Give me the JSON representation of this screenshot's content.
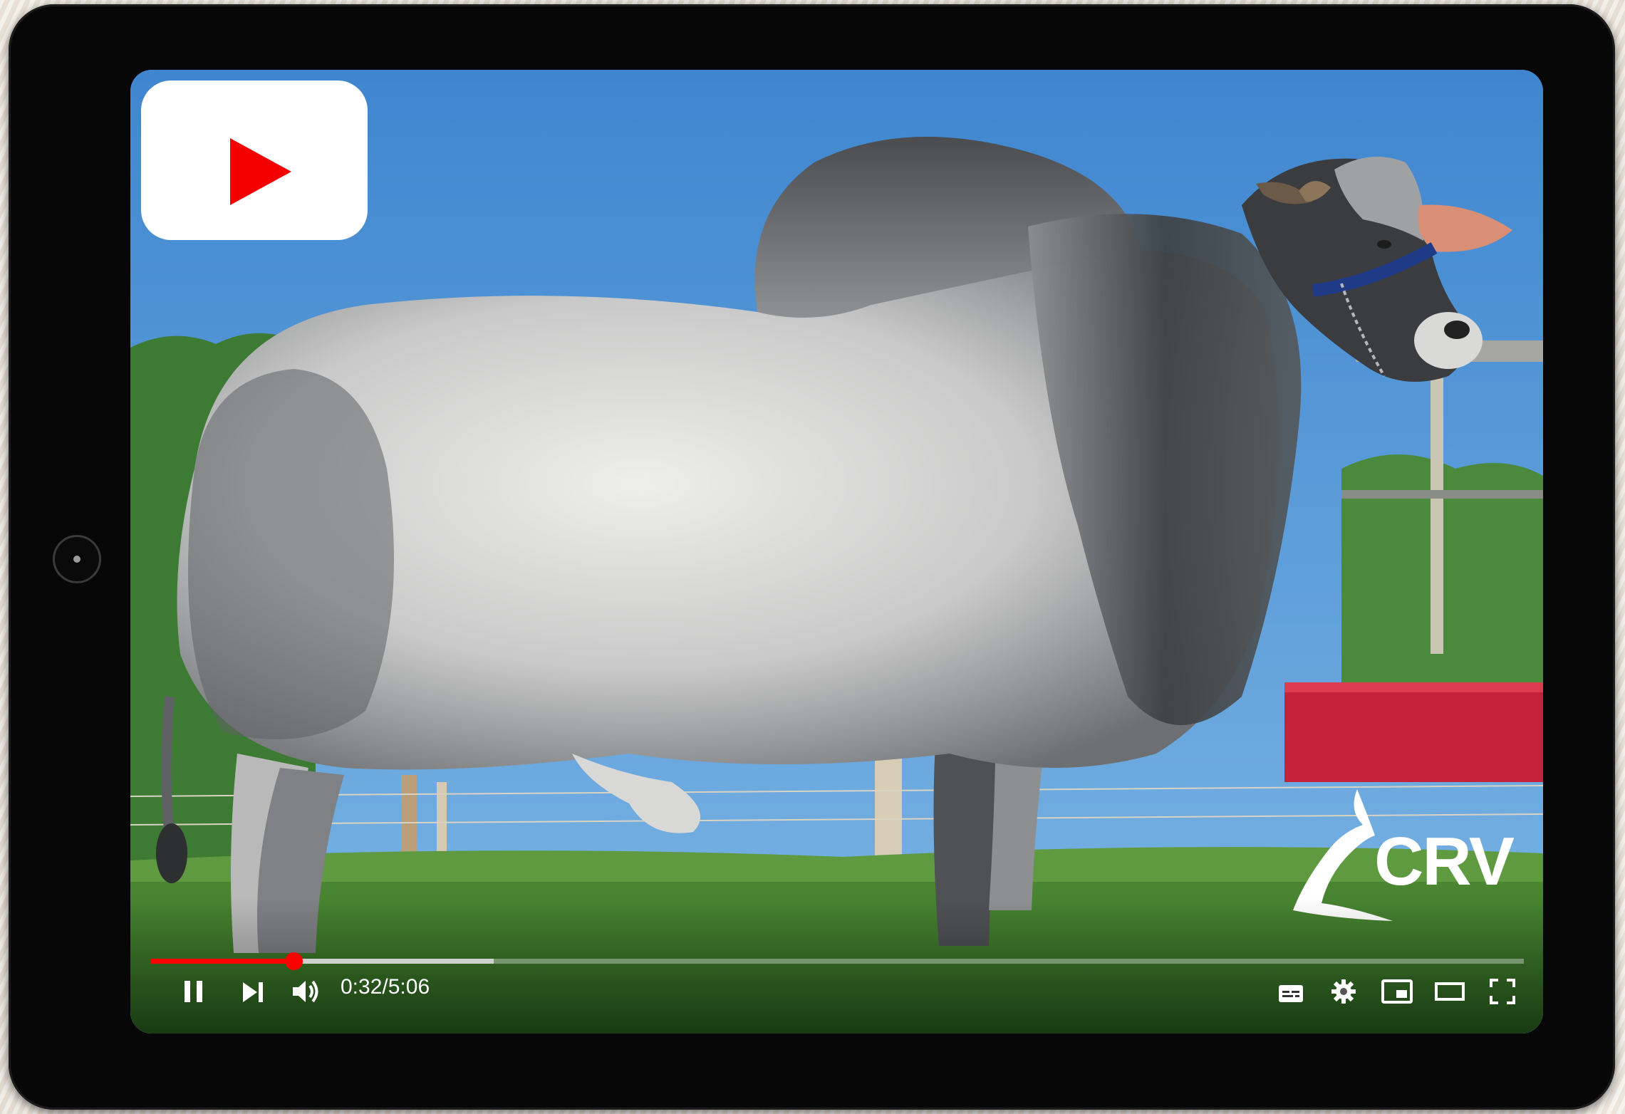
{
  "player": {
    "time_current": "0:32",
    "time_separator": "/",
    "time_total": "5:06",
    "progress_fraction": 0.104,
    "buffered_fraction": 0.25
  },
  "brand": {
    "crv_text": "CRV",
    "youtube_logo": "youtube-play-icon"
  },
  "colors": {
    "progress": "#ff0000",
    "youtube_red": "#f40000",
    "tablet": "#070707"
  },
  "icons": [
    "pause-icon",
    "next-icon",
    "volume-icon",
    "subtitles-icon",
    "settings-icon",
    "miniplayer-icon",
    "theater-mode-icon",
    "fullscreen-icon"
  ]
}
